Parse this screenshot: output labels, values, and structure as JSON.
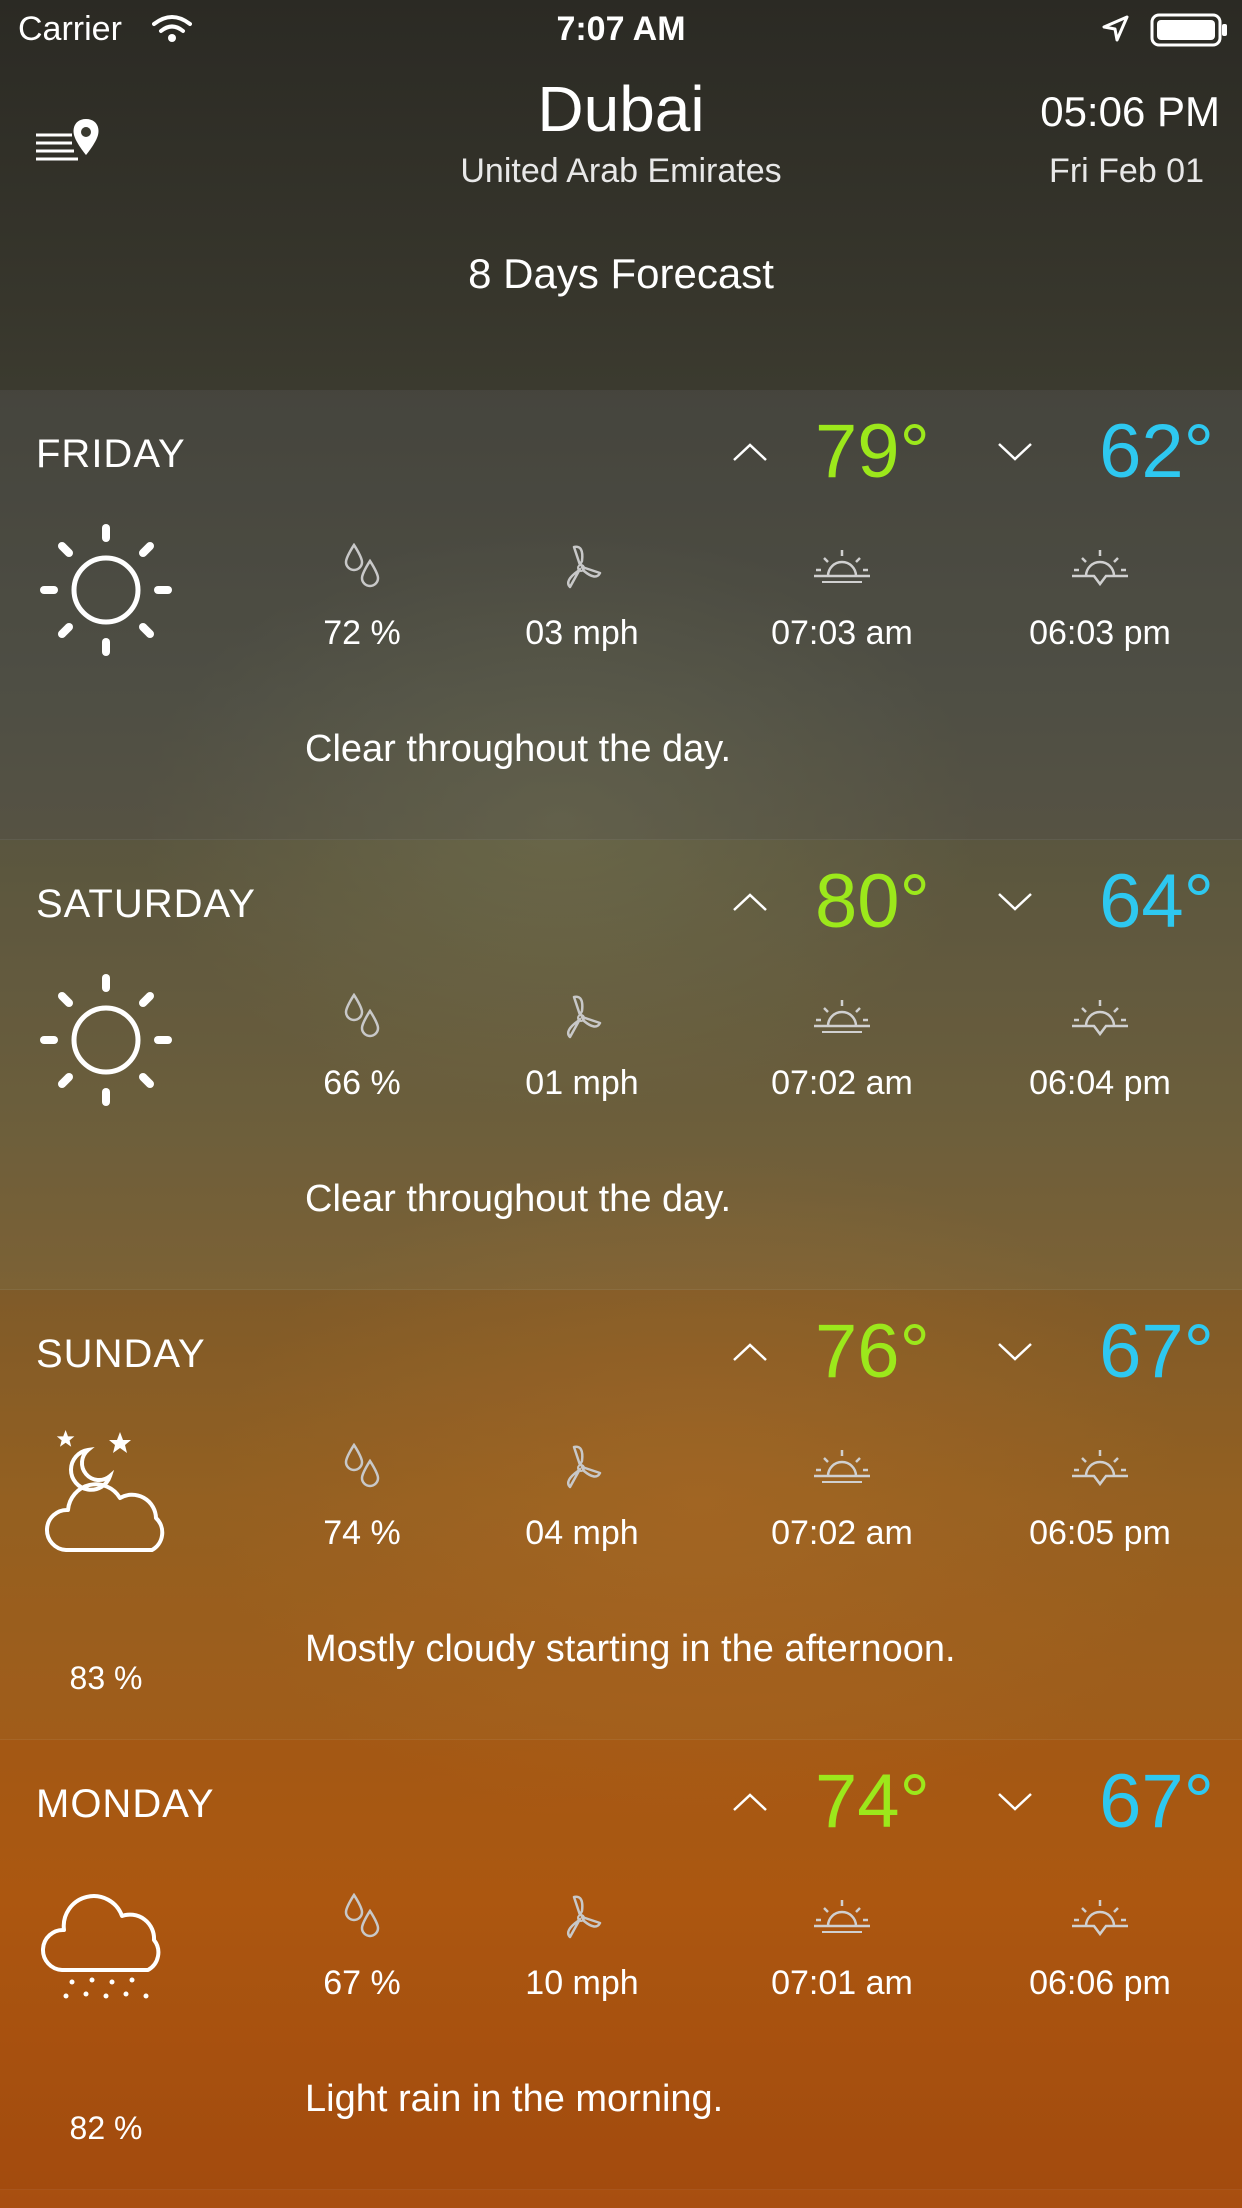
{
  "status_bar": {
    "carrier": "Carrier",
    "time": "7:07 AM"
  },
  "header": {
    "city": "Dubai",
    "country": "United Arab Emirates",
    "local_time": "05:06 PM",
    "local_date": "Fri Feb 01",
    "forecast_title": "8 Days Forecast"
  },
  "colors": {
    "high_temp": "#9ce81b",
    "low_temp": "#2ec8f0"
  },
  "days": [
    {
      "name": "FRIDAY",
      "high": "79°",
      "low": "62°",
      "icon": "sun-icon",
      "cloud_pct": "",
      "humidity": "72 %",
      "wind": "03 mph",
      "sunrise": "07:03 am",
      "sunset": "06:03 pm",
      "summary": "Clear throughout the day."
    },
    {
      "name": "SATURDAY",
      "high": "80°",
      "low": "64°",
      "icon": "sun-icon",
      "cloud_pct": "",
      "humidity": "66 %",
      "wind": "01 mph",
      "sunrise": "07:02 am",
      "sunset": "06:04 pm",
      "summary": "Clear throughout the day."
    },
    {
      "name": "SUNDAY",
      "high": "76°",
      "low": "67°",
      "icon": "partly-cloudy-night-icon",
      "cloud_pct": "83 %",
      "humidity": "74 %",
      "wind": "04 mph",
      "sunrise": "07:02 am",
      "sunset": "06:05 pm",
      "summary": "Mostly cloudy starting in the afternoon."
    },
    {
      "name": "MONDAY",
      "high": "74°",
      "low": "67°",
      "icon": "rain-cloud-icon",
      "cloud_pct": "82 %",
      "humidity": "67 %",
      "wind": "10 mph",
      "sunrise": "07:01 am",
      "sunset": "06:06 pm",
      "summary": "Light rain in the morning."
    }
  ]
}
